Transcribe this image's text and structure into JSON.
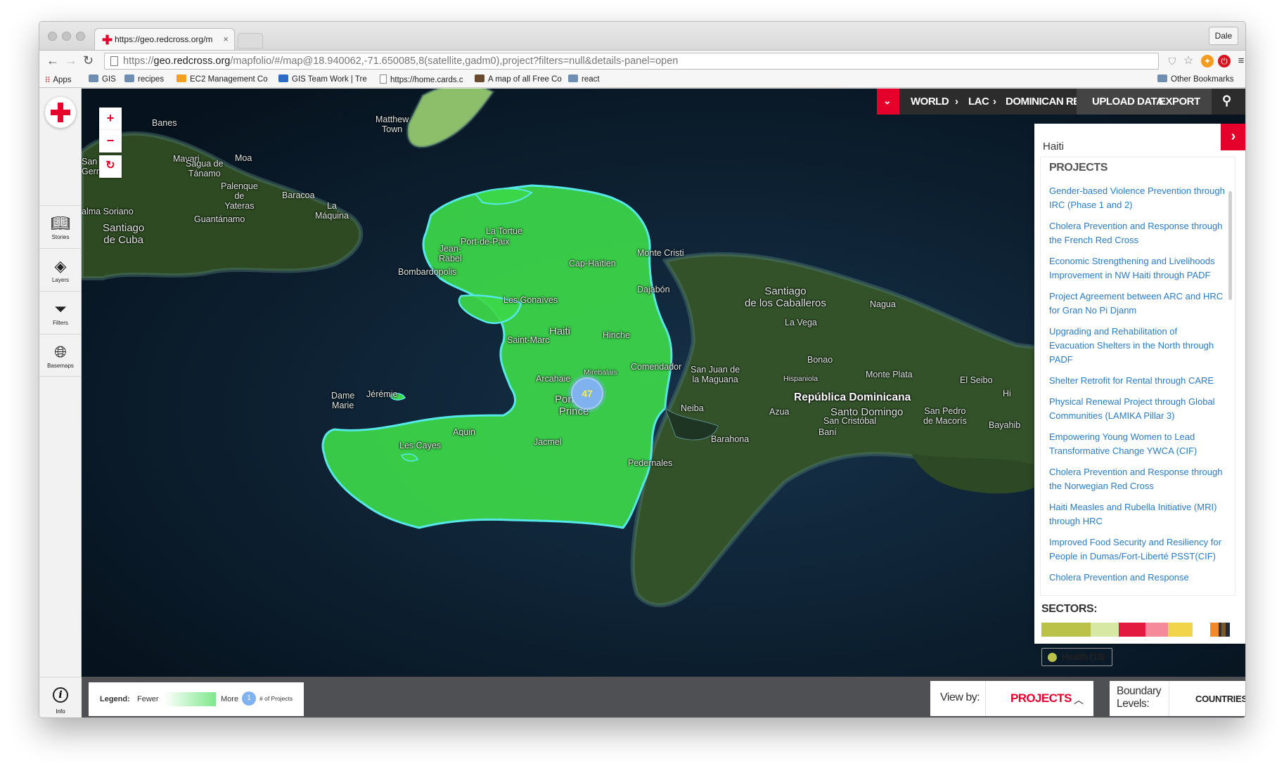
{
  "browser": {
    "tab_title": "https://geo.redcross.org/m",
    "tab_close": "×",
    "profile": "Dale",
    "url_scheme": "https://",
    "url_host": "geo.redcross.org",
    "url_path": "/mapfolio/#/map@18.940062,-71.650085,8(satellite,gadm0),project?filters=null&details-panel=open",
    "bookmarks": [
      "Apps",
      "GIS",
      "recipes",
      "EC2 Management Co",
      "GIS Team Work | Tre",
      "https://home.cards.c",
      "A map of all Free Co",
      "react"
    ],
    "other_bookmarks": "Other Bookmarks"
  },
  "sidebar": {
    "items": [
      {
        "label": "Stories",
        "icon": "book-icon"
      },
      {
        "label": "Layers",
        "icon": "layers-icon"
      },
      {
        "label": "Filters",
        "icon": "funnel-icon"
      },
      {
        "label": "Basemaps",
        "icon": "globe-icon"
      }
    ],
    "info_label": "Info"
  },
  "zoom": {
    "in": "+",
    "out": "−",
    "reset": "↻"
  },
  "topnav": {
    "breadcrumbs": [
      "WORLD",
      "LAC",
      "DOMINICAN REPUBLIC"
    ],
    "separator": "›",
    "upload": "UPLOAD DATA",
    "export": "EXPORT"
  },
  "map_labels": {
    "banes": "Banes",
    "san_german": "San\nGermán",
    "mavari": "Mavari",
    "sagua": "Sagua de\nTánamo",
    "moa": "Moa",
    "palenque": "Palenque\nde\nYateras",
    "baracoa": "Baracoa",
    "alma_soriano": "alma Soriano",
    "guantanamo": "Guantánamo",
    "la_maquina": "La\nMáquina",
    "santiago_cuba": "Santiago\nde Cuba",
    "matthew_town": "Matthew\nTown",
    "la_tortue": "La Tortue",
    "port_de_paix": "Port-de-Paix",
    "jean_rabel": "Jean-\nRabel",
    "bombardopolis": "Bombardopolis",
    "cap_haitien": "Cap-Haïtien",
    "monte_cristi": "Monte Cristi",
    "dajabon": "Dajabón",
    "les_gonaives": "Les Gonaïves",
    "haiti": "Haiti",
    "hinche": "Hinche",
    "saint_marc": "Saint-Marc",
    "mirebalais": "Mirebalais",
    "arcahaie": "Arcahaie",
    "comendador": "Comendador",
    "san_juan": "San Juan de\nla Maguana",
    "port_au_prince": "Port-au-\nPrince",
    "jeremie": "Jérémie",
    "dame_marie": "Dame\nMarie",
    "les_cayes": "Les Cayes",
    "aquin": "Aquin",
    "jacmel": "Jacmel",
    "pedernales": "Pedernales",
    "barahona": "Barahona",
    "neiba": "Neiba",
    "azua": "Azua",
    "bani": "Baní",
    "santiago_caballeros": "Santiago\nde los Caballeros",
    "la_vega": "La Vega",
    "nagua": "Nagua",
    "bonao": "Bonao",
    "hispaniola": "Hispaniola",
    "monte_plata": "Monte Plata",
    "el_seibo": "El Seibo",
    "republica_dominicana": "República Dominicana",
    "santo_domingo": "Santo Domingo",
    "san_cristobal": "San Cristóbal",
    "san_pedro": "San Pedro\nde Macorís",
    "bayahibe": "Bayahib",
    "hi": "Hi"
  },
  "cluster": {
    "count": "47",
    "color": "#7fb2ee"
  },
  "details_panel": {
    "title": "Haiti",
    "projects_heading": "PROJECTS",
    "projects": [
      "Gender-based Violence Prevention through IRC (Phase 1 and 2)",
      "Cholera Prevention and Response through the French Red Cross",
      "Economic Strengthening and Livelihoods Improvement in NW Haiti through PADF",
      "Project Agreement between ARC and HRC for Gran No Pi Djanm",
      "Upgrading and Rehabilitation of Evacuation Shelters in the North through PADF",
      "Shelter Retrofit for Rental through CARE",
      "Physical Renewal Project through Global Communities (LAMIKA Pillar 3)",
      "Empowering Young Women to Lead Transformative Change YWCA (CIF)",
      "Cholera Prevention and Response through the Norwegian Red Cross",
      "Haiti Measles and Rubella Initiative (MRI) through HRC",
      "Improved Food Security and Resiliency for People in Dumas/Fort-Liberté PSST(CIF)",
      "Cholera Prevention and Response"
    ],
    "sectors_heading": "SECTORS:",
    "sector_colors": [
      "#bac24a",
      "#d6e8a4",
      "#e4193f",
      "#f58a9a",
      "#f2d44a",
      "#ffffff",
      "#f08a2a",
      "#333333"
    ],
    "health_chip": "Health (13)"
  },
  "legend": {
    "title": "Legend:",
    "fewer": "Fewer",
    "more": "More",
    "dot": "1",
    "count_label": "# of Projects"
  },
  "viewby": {
    "label": "View by:",
    "value": "PROJECTS"
  },
  "boundary": {
    "label": "Boundary\nLevels:",
    "value": "COUNTRIES"
  },
  "colors": {
    "accent": "#e4002b",
    "link": "#2a7bc6",
    "haiti_fill": "#3dd84a",
    "haiti_stroke": "#56e8e8"
  }
}
